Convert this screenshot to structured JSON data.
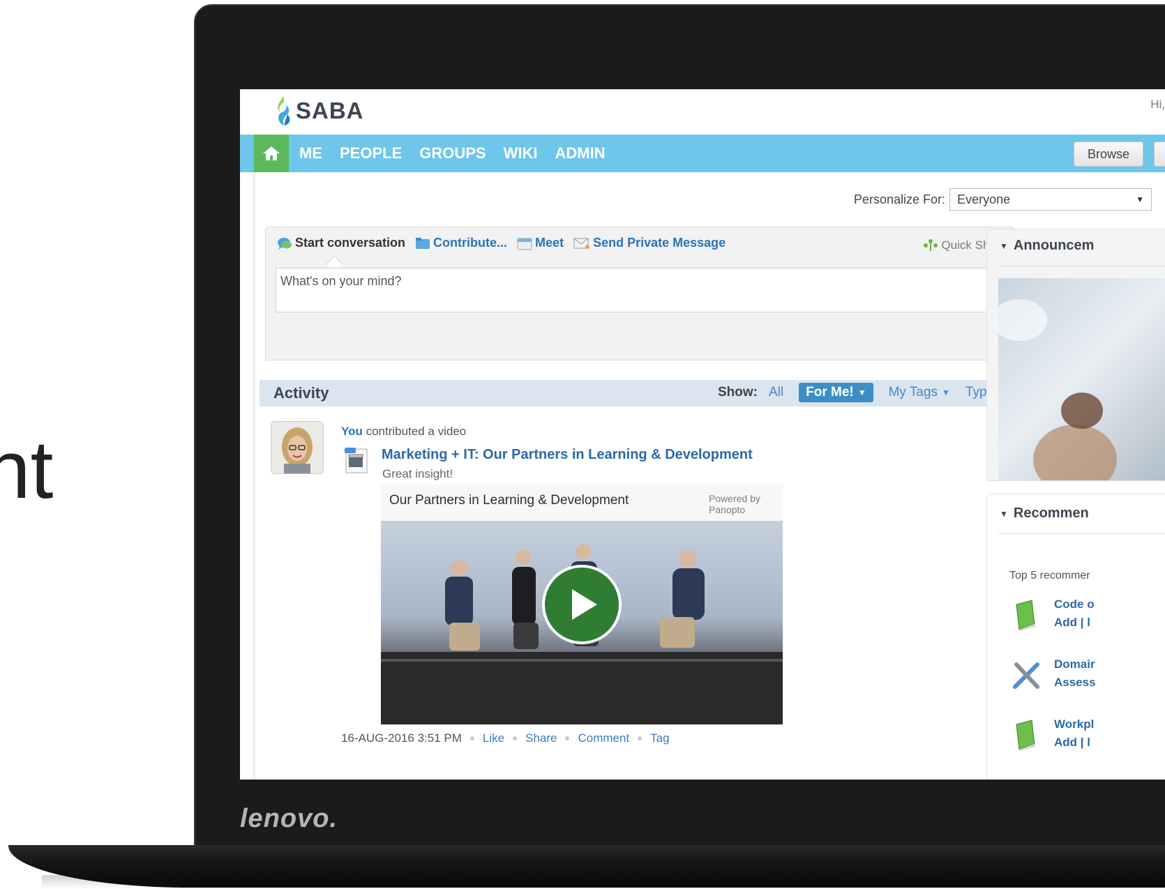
{
  "slide": {
    "partial_text": "nt"
  },
  "device": {
    "brand": "lenovo."
  },
  "app": {
    "logo_text": "SABA",
    "greeting": "Hi,"
  },
  "nav": {
    "items": [
      {
        "label": "ME"
      },
      {
        "label": "PEOPLE"
      },
      {
        "label": "GROUPS"
      },
      {
        "label": "WIKI"
      },
      {
        "label": "ADMIN"
      }
    ],
    "browse_label": "Browse"
  },
  "personalize": {
    "label": "Personalize For:",
    "value": "Everyone"
  },
  "composer": {
    "actions": [
      {
        "label": "Start conversation",
        "icon": "chat-bubble-icon"
      },
      {
        "label": "Contribute...",
        "icon": "folder-icon"
      },
      {
        "label": "Meet",
        "icon": "calendar-icon"
      },
      {
        "label": "Send Private Message",
        "icon": "envelope-icon"
      }
    ],
    "quick_share": "Quick Share",
    "placeholder": "What's on your mind?"
  },
  "activity": {
    "title": "Activity",
    "show_label": "Show:",
    "filters": {
      "all": "All",
      "for_me": "For Me!",
      "my_tags": "My Tags",
      "type": "Type"
    }
  },
  "post": {
    "actor": "You",
    "action": "contributed a video",
    "title": "Marketing + IT: Our Partners in Learning & Development",
    "subtitle": "Great insight!",
    "video_title": "Our Partners in Learning & Development",
    "powered_by": "Powered by",
    "powered_name": "Panopto",
    "timestamp": "16-AUG-2016 3:51 PM",
    "footer_actions": {
      "like": "Like",
      "share": "Share",
      "comment": "Comment",
      "tag": "Tag"
    }
  },
  "right": {
    "announcements_title": "Announcem",
    "recommend_title": "Recommen",
    "recommend_intro": "Top 5 recommer",
    "recommendations": [
      {
        "title": "Code o",
        "actions": "Add | l",
        "icon": "book-icon"
      },
      {
        "title": "Domair",
        "actions": "Assess",
        "icon": "tools-icon"
      },
      {
        "title": "Workpl",
        "actions": "Add | l",
        "icon": "book-icon"
      }
    ]
  },
  "colors": {
    "nav_bg": "#6ec6ea",
    "home_bg": "#5cb85c",
    "link": "#2a74b8",
    "activity_bar": "#dae5ef",
    "pill": "#3c8fc4"
  }
}
